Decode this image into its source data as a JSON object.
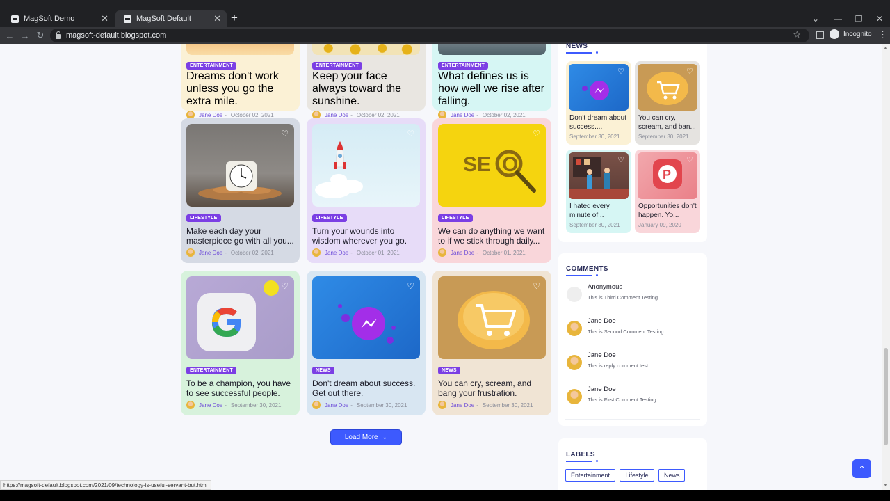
{
  "browser": {
    "tabs": [
      {
        "label": "MagSoft Demo",
        "active": false
      },
      {
        "label": "MagSoft Default",
        "active": true
      }
    ],
    "url": "magsoft-default.blogspot.com",
    "profile": "Incognito"
  },
  "top_posts": [
    {
      "badge": "ENTERTAINMENT",
      "title": "Dreams don't work unless you go the extra mile.",
      "author": "Jane Doe",
      "date": "October 02, 2021"
    },
    {
      "badge": "ENTERTAINMENT",
      "title": "Keep your face always toward the sunshine.",
      "author": "Jane Doe",
      "date": "October 02, 2021"
    },
    {
      "badge": "ENTERTAINMENT",
      "title": "What defines us is how well we rise after falling.",
      "author": "Jane Doe",
      "date": "October 02, 2021"
    }
  ],
  "posts": [
    {
      "badge": "LIFESTYLE",
      "title": "Make each day your masterpiece go with all you...",
      "author": "Jane Doe",
      "date": "October 02, 2021"
    },
    {
      "badge": "LIFESTYLE",
      "title": "Turn your wounds into wisdom wherever you go.",
      "author": "Jane Doe",
      "date": "October 01, 2021"
    },
    {
      "badge": "LIFESTYLE",
      "title": "We can do anything we want to if we stick through daily...",
      "author": "Jane Doe",
      "date": "October 01, 2021"
    },
    {
      "badge": "ENTERTAINMENT",
      "title": "To be a champion, you have to see successful people.",
      "author": "Jane Doe",
      "date": "September 30, 2021"
    },
    {
      "badge": "NEWS",
      "title": "Don't dream about success. Get out there.",
      "author": "Jane Doe",
      "date": "September 30, 2021"
    },
    {
      "badge": "NEWS",
      "title": "You can cry, scream, and bang your frustration.",
      "author": "Jane Doe",
      "date": "September 30, 2021"
    }
  ],
  "meta_sep": "-",
  "load_more": "Load More",
  "sidebar": {
    "news_heading": "NEWS",
    "news": [
      {
        "title": "Don't dream about success....",
        "date": "September 30, 2021"
      },
      {
        "title": "You can cry, scream, and ban...",
        "date": "September 30, 2021"
      },
      {
        "title": "I hated every minute of...",
        "date": "September 30, 2021"
      },
      {
        "title": "Opportunities don't happen. Yo...",
        "date": "January 09, 2020"
      }
    ],
    "comments_heading": "COMMENTS",
    "comments": [
      {
        "name": "Anonymous",
        "text": "This is Third Comment Testing."
      },
      {
        "name": "Jane Doe",
        "text": "This is Second Comment Testing."
      },
      {
        "name": "Jane Doe",
        "text": "This is reply comment test."
      },
      {
        "name": "Jane Doe",
        "text": "This is First Comment Testing."
      }
    ],
    "labels_heading": "LABELS",
    "labels": [
      "Entertainment",
      "Lifestyle",
      "News"
    ]
  },
  "status_url": "https://magsoft-default.blogspot.com/2021/09/technology-is-useful-servant-but.html",
  "colors": {
    "accent": "#3d5afe",
    "badge": "#7b3fe4"
  },
  "icons": [
    "heart-icon",
    "chevron-down-icon",
    "arrow-up-icon",
    "star-icon",
    "lock-icon"
  ]
}
